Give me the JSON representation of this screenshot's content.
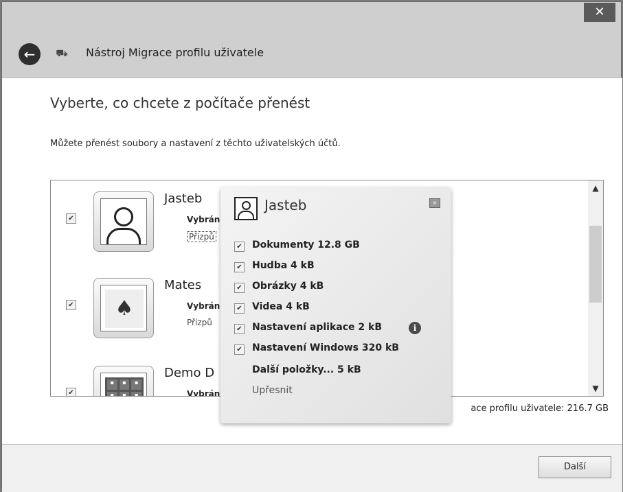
{
  "window": {
    "close_label": "✕",
    "title": "Nástroj Migrace profilu uživatele"
  },
  "main": {
    "heading": "Vyberte, co chcete z počítače přenést",
    "description": "Můžete přenést soubory a nastavení z těchto uživatelských účtů.",
    "accounts": [
      {
        "name": "Jasteb",
        "selected_label": "Vybrán",
        "customize_label": "Přizpů",
        "checked": "✔"
      },
      {
        "name": "Mates",
        "selected_label": "Vybrán",
        "customize_label": "Přizpů",
        "checked": "✔"
      },
      {
        "name": "Demo D",
        "selected_label": "Vybrán",
        "checked": "✔"
      }
    ],
    "total_size": "ace profilu uživatele: 216.7 GB"
  },
  "popup": {
    "name": "Jasteb",
    "items": [
      {
        "label": "Dokumenty 12.8 GB",
        "checked": "✔"
      },
      {
        "label": "Hudba 4 kB",
        "checked": "✔"
      },
      {
        "label": "Obrázky 4 kB",
        "checked": "✔"
      },
      {
        "label": "Videa 4 kB",
        "checked": "✔"
      },
      {
        "label": "Nastavení aplikace 2 kB",
        "checked": "✔"
      },
      {
        "label": "Nastavení Windows 320 kB",
        "checked": "✔"
      }
    ],
    "more_items": "Další položky... 5 kB",
    "refine": "Upřesnit",
    "info_glyph": "i"
  },
  "footer": {
    "next_label": "Další"
  },
  "icons": {
    "back": "back-arrow-icon",
    "app": "migration-icon",
    "close": "close-icon",
    "info": "info-icon"
  }
}
